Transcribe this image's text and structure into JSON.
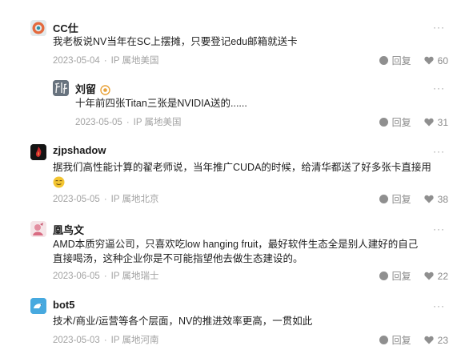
{
  "labels": {
    "reply": "回复",
    "more": "···"
  },
  "comments": [
    {
      "name": "CC仕",
      "text": "我老板说NV当年在SC上摆摊，只要登记edu邮箱就送卡",
      "date": "2023-05-04",
      "location": "IP 属地美国",
      "likes": "60"
    },
    {
      "name": "刘留",
      "text": "十年前四张Titan三张是NVIDIA送的......",
      "date": "2023-05-05",
      "location": "IP 属地美国",
      "likes": "31"
    },
    {
      "name": "zjpshadow",
      "text": "据我们高性能计算的翟老师说，当年推广CUDA的时候，给清华都送了好多张卡直接用",
      "date": "2023-05-05",
      "location": "IP 属地北京",
      "likes": "38"
    },
    {
      "name": "凰鸟文",
      "text_lines": [
        "AMD本质穷逼公司，只喜欢吃low hanging fruit，最好软件生态全是别人建好的自己",
        "直接喝汤，这种企业你是不可能指望他去做生态建设的。"
      ],
      "date": "2023-06-05",
      "location": "IP 属地瑞士",
      "likes": "22"
    },
    {
      "name": "bot5",
      "text": "技术/商业/运营等各个层面，NV的推进效率更高，一贯如此",
      "date": "2023-05-03",
      "location": "IP 属地河南",
      "likes": "23"
    }
  ]
}
